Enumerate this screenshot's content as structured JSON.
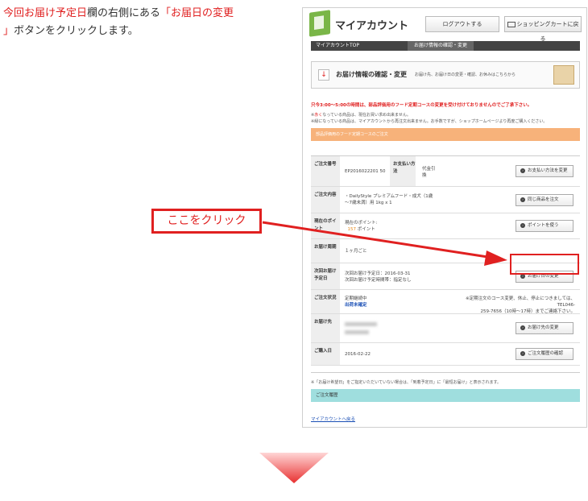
{
  "instruction": {
    "part1": "今回お届け予定日",
    "part2": "欄の右側にある",
    "part3": "「お届日の変更",
    "part4": "」",
    "part5": "ボタンをクリックします。"
  },
  "header": {
    "title": "マイアカウント",
    "logout_label": "ログアウトする",
    "cart_label": "ショッピングカートに戻る"
  },
  "breadcrumb": {
    "top": "マイアカウントTOP",
    "current": "お届け情報の確認・変更"
  },
  "section": {
    "title": "お届け情報の確認・変更",
    "description": "お届け先、お届け日の変更・確認、お休みはこちらから"
  },
  "notices": {
    "red": "只今3:00～5:00の時間は、部品評価用のフード定期コースの変更を受け付けておりませんのでご了承下さい。",
    "line1_prefix": "※",
    "line1_red": "赤く",
    "line1_rest": "なっている商品は、現在お買い求め出来ません。",
    "line2": "※緑になっている商品は、マイアカウントから再注文出来ません。お手数ですが、ショップホームページより再度ご購入ください。"
  },
  "course_bar": "部品評価用のフード定期コースのご注文",
  "order": {
    "no_label": "ご注文番号",
    "no_value": "EP2016022201 50",
    "payment_label": "お支払い方法",
    "payment_value": "代金引換",
    "payment_btn": "お支払い方法を変更",
    "content_label": "ご注文内容",
    "content_value1": "・DailyStyle プレミアムフード・成犬（1歳",
    "content_value2": "〜7歳未満）用 1kg x 1",
    "content_btn": "同じ商品を注文",
    "points_label": "現在のポイント",
    "points_value_label": "現在のポイント:",
    "points_value": "157",
    "points_unit": "ポイント",
    "points_btn": "ポイントを使う",
    "cycle_label": "お届け周期",
    "cycle_value": "１ヶ月ごと",
    "next_label": "次回お届け予定日",
    "next_value1": "次回お届け予定日：2016-03-31",
    "next_value2": "次回お届け予定時間帯：指定なし",
    "next_btn": "お届け日の変更",
    "status_label": "ご注文状況",
    "status_value1": "定期継続中",
    "status_value2": "出荷未確定",
    "status_note1": "※定期注文のコース変更、休止、停止につきましては、TEL046-",
    "status_note2": "259-7656（10時〜17時）までご連絡下さい。",
    "dest_label": "お届け先",
    "dest_btn": "お届け先の変更",
    "purchase_label": "ご購入日",
    "purchase_value": "2016-02-22",
    "purchase_btn": "ご注文履歴の確認"
  },
  "foot_note": "※「お届け希望日」をご指定いただいていない場合は、「到着予定日」に「最短お届け」と表示されます。",
  "history_bar": "ご注文履歴",
  "back_link": "マイアカウントへ戻る",
  "callout": "ここをクリック",
  "colors": {
    "accent_red": "#e02020",
    "orange_bar": "#f7b27a",
    "teal_bar": "#9fdede"
  }
}
